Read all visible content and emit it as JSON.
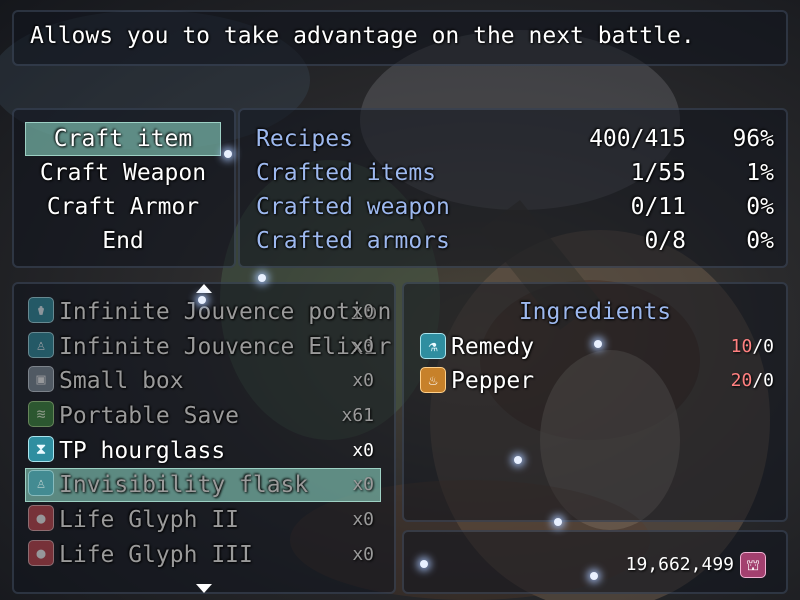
{
  "help": {
    "text": "Allows you to take advantage on the next battle."
  },
  "commands": [
    {
      "label": "Craft item",
      "selected": true
    },
    {
      "label": "Craft Weapon"
    },
    {
      "label": "Craft Armor"
    },
    {
      "label": "End"
    }
  ],
  "stats": [
    {
      "label": "Recipes",
      "count": "400/415",
      "percent": "96%"
    },
    {
      "label": "Crafted items",
      "count": "1/55",
      "percent": "1%"
    },
    {
      "label": "Crafted weapon",
      "count": "0/11",
      "percent": "0%"
    },
    {
      "label": "Crafted armors",
      "count": "0/8",
      "percent": "0%"
    }
  ],
  "items": [
    {
      "name": "Infinite Jouvence potion",
      "qty": "x0",
      "icon": "potion-bottle-icon",
      "enabled": false
    },
    {
      "name": "Infinite Jouvence Elixir",
      "qty": "x0",
      "icon": "elixir-figure-icon",
      "enabled": false
    },
    {
      "name": "Small box",
      "qty": "x0",
      "icon": "box-icon",
      "enabled": false
    },
    {
      "name": "Portable Save",
      "qty": "x61",
      "icon": "scroll-icon",
      "enabled": false
    },
    {
      "name": "TP hourglass",
      "qty": "x0",
      "icon": "hourglass-icon",
      "enabled": true
    },
    {
      "name": "Invisibility flask",
      "qty": "x0",
      "icon": "flask-figure-icon",
      "enabled": false,
      "selected": true
    },
    {
      "name": "Life Glyph II",
      "qty": "x0",
      "icon": "red-glyph-icon",
      "enabled": false
    },
    {
      "name": "Life Glyph III",
      "qty": "x0",
      "icon": "red-glyph-icon",
      "enabled": false
    }
  ],
  "ingredients": {
    "header": "Ingredients",
    "list": [
      {
        "name": "Remedy",
        "have": "10",
        "need": "/0",
        "icon": "remedy-jar-icon"
      },
      {
        "name": "Pepper",
        "have": "20",
        "need": "/0",
        "icon": "pepper-bottle-icon"
      }
    ]
  },
  "gold": {
    "value": "19,662,499",
    "icon": "gold-currency-icon"
  },
  "colors": {
    "system_text": "#9db8ee",
    "highlight": "#96e6d2",
    "insufficient": "#ff8080"
  }
}
